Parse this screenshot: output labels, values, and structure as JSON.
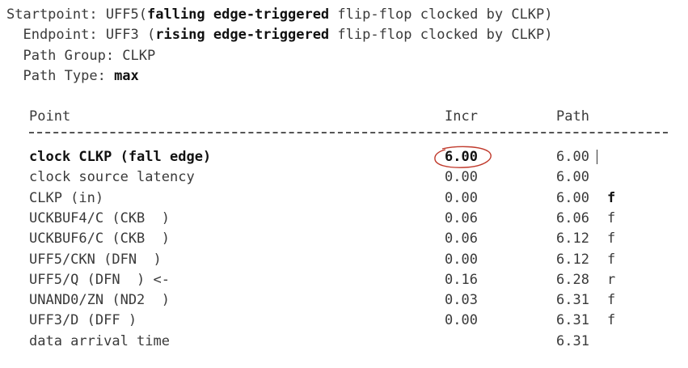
{
  "header": {
    "start_prefix": "Startpoint: UFF5(",
    "start_bold": "falling edge-triggered",
    "start_suffix": " flip-flop clocked by CLKP)",
    "end_prefix": "  Endpoint: UFF3 (",
    "end_bold": "rising edge-triggered",
    "end_suffix": " flip-flop clocked by CLKP)",
    "path_group": "  Path Group: CLKP",
    "path_type_label": "  Path Type: ",
    "path_type_value": "max"
  },
  "columns": {
    "point": "Point",
    "incr": "Incr",
    "path": "Path"
  },
  "rows": [
    {
      "point": "clock CLKP (fall edge)",
      "incr": "6.00",
      "path": "6.00",
      "flag": ""
    },
    {
      "point": "clock source latency",
      "incr": "0.00",
      "path": "6.00",
      "flag": ""
    },
    {
      "point": "CLKP (in)",
      "incr": "0.00",
      "path": "6.00",
      "flag": "f"
    },
    {
      "point": "UCKBUF4/C (CKB  )",
      "incr": "0.06",
      "path": "6.06",
      "flag": "f"
    },
    {
      "point": "UCKBUF6/C (CKB  )",
      "incr": "0.06",
      "path": "6.12",
      "flag": "f"
    },
    {
      "point": "UFF5/CKN (DFN  )",
      "incr": "0.00",
      "path": "6.12",
      "flag": "f"
    },
    {
      "point": "UFF5/Q (DFN  ) <-",
      "incr": "0.16",
      "path": "6.28",
      "flag": "r"
    },
    {
      "point": "UNAND0/ZN (ND2  )",
      "incr": "0.03",
      "path": "6.31",
      "flag": "f"
    },
    {
      "point": "UFF3/D (DFF )",
      "incr": "0.00",
      "path": "6.31",
      "flag": "f"
    },
    {
      "point": "data arrival time",
      "incr": "",
      "path": "6.31",
      "flag": ""
    }
  ],
  "annotation": {
    "circle_color": "#c0392b"
  }
}
